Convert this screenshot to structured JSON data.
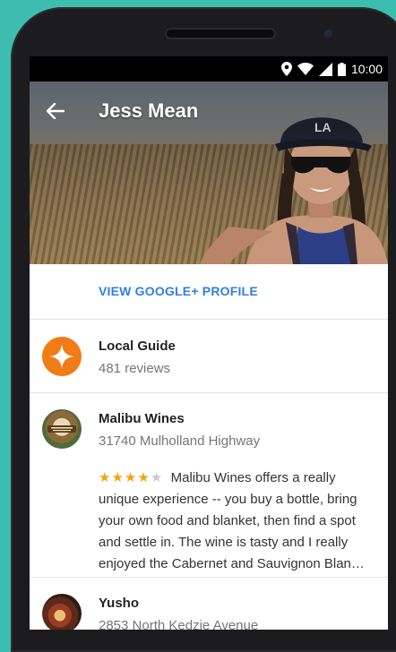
{
  "status_bar": {
    "time": "10:00",
    "icons": [
      "location-pin-icon",
      "wifi-icon",
      "signal-icon",
      "battery-icon"
    ]
  },
  "header": {
    "title": "Jess Mean",
    "back_icon": "arrow-left-icon"
  },
  "profile_link": "VIEW GOOGLE+ PROFILE",
  "local_guide": {
    "title": "Local Guide",
    "subtitle": "481 reviews",
    "icon": "local-guide-star-icon"
  },
  "reviews": [
    {
      "place": "Malibu Wines",
      "address": "31740 Mulholland Highway",
      "rating": 4,
      "max_rating": 5,
      "text": "Malibu Wines offers a really unique experience -- you buy a bottle, bring your own food and blanket, then find a spot and settle in. The wine is tasty and I really enjoyed the Cabernet and Sauvignon Blan…"
    },
    {
      "place": "Yusho",
      "address": "2853 North Kedzie Avenue"
    }
  ],
  "colors": {
    "background": "#3dbdb0",
    "link_blue": "#2f7fe5",
    "guide_orange": "#f17b15",
    "star_gold": "#f5a40c"
  }
}
